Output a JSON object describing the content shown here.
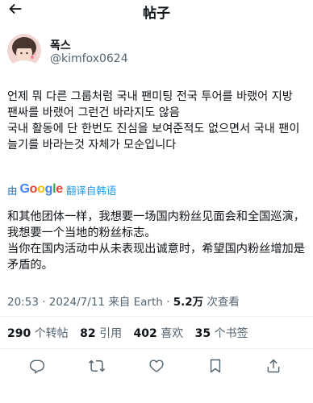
{
  "header": {
    "title": "帖子"
  },
  "user": {
    "name": "폭스",
    "handle": "@kimfox0624"
  },
  "tweet": {
    "text": "언제 뭐 다른 그룹처럼 국내 팬미팅 전국 투어를 바랬어 지방 팬싸를 바랬어 그런건 바라지도 않음\n국내 활동에 단 한번도 진심을 보여준적도 없으면서 국내 팬이 늘기를 바라는것 자체가 모순입니다"
  },
  "translation": {
    "by": "由",
    "provider": "Google",
    "label": "翻译自韩语",
    "text": "和其他团体一样，我想要一场国内粉丝见面会和全国巡演，我想要一个当地的粉丝标志。\n当你在国内活动中从未表现出诚意时，希望国内粉丝增加是矛盾的。"
  },
  "meta": {
    "time": "20:53",
    "date": "2024/7/11",
    "source": "来自 Earth",
    "views": "5.2万",
    "views_label": "次查看"
  },
  "stats": {
    "retweets": "290",
    "retweets_label": "个转帖",
    "quotes": "82",
    "quotes_label": "引用",
    "likes": "402",
    "likes_label": "喜欢",
    "bookmarks": "35",
    "bookmarks_label": "个书签"
  },
  "icons": {
    "back": "arrow-left-icon",
    "reply": "reply-icon",
    "retweet": "retweet-icon",
    "like": "heart-icon",
    "bookmark": "bookmark-icon",
    "share": "share-icon"
  },
  "colors": {
    "link": "#1d9bf0",
    "muted": "#536471",
    "text": "#0f1419"
  }
}
